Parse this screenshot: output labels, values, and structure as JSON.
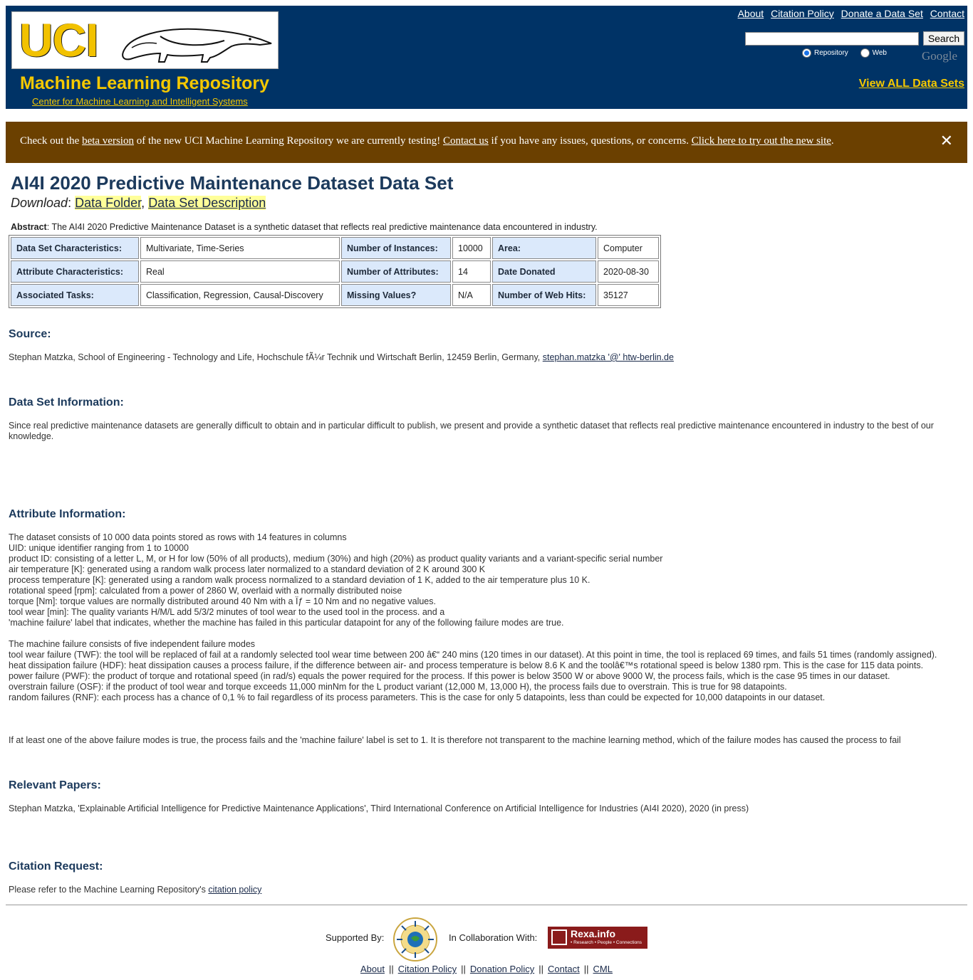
{
  "header": {
    "logo_text": "UCI",
    "title": "Machine Learning Repository",
    "subtitle_link": "Center for Machine Learning and Intelligent Systems",
    "top_links": [
      "About",
      "Citation Policy",
      "Donate a Data Set",
      "Contact"
    ],
    "search_button": "Search",
    "radio_repository": "Repository",
    "radio_web": "Web",
    "google_label": "Google",
    "view_all": "View ALL Data Sets",
    "colors": {
      "background": "#003366",
      "accent": "#f5c800"
    }
  },
  "banner": {
    "text1": "Check out the ",
    "link1": "beta version",
    "text2": " of the new UCI Machine Learning Repository we are currently testing! ",
    "link2": "Contact us",
    "text3": " if you have any issues, questions, or concerns. ",
    "link3": "Click here to try out the new site",
    "text4": ".",
    "close": "✕",
    "color": "#6b4000"
  },
  "dataset": {
    "title": "AI4I 2020 Predictive Maintenance Dataset Data Set",
    "download_label": "Download",
    "download_sep": ":",
    "data_folder": "Data Folder",
    "comma": ",",
    "description": "Data Set Description",
    "abstract_label": "Abstract",
    "abstract_text": ": The AI4I 2020 Predictive Maintenance Dataset is a synthetic dataset that reflects real predictive maintenance data encountered in industry.",
    "table": [
      [
        "Data Set Characteristics:",
        "Multivariate, Time-Series",
        "Number of Instances:",
        "10000",
        "Area:",
        "Computer"
      ],
      [
        "Attribute Characteristics:",
        "Real",
        "Number of Attributes:",
        "14",
        "Date Donated",
        "2020-08-30"
      ],
      [
        "Associated Tasks:",
        "Classification, Regression, Causal-Discovery",
        "Missing Values?",
        "N/A",
        "Number of Web Hits:",
        "35127"
      ]
    ]
  },
  "source": {
    "heading": "Source:",
    "text": "Stephan Matzka, School of Engineering - Technology and Life, Hochschule fÃ¼r Technik und Wirtschaft Berlin, 12459 Berlin, Germany, ",
    "email": "stephan.matzka '@' htw-berlin.de"
  },
  "info": {
    "heading": "Data Set Information:",
    "text": "Since real predictive maintenance datasets are generally difficult to obtain and in particular difficult to publish, we present and provide a synthetic dataset that reflects real predictive maintenance encountered in industry to the best of our knowledge."
  },
  "attributes": {
    "heading": "Attribute Information:",
    "lines": [
      "The dataset consists of 10 000 data points stored as rows with 14 features in columns",
      "UID: unique identifier ranging from 1 to 10000",
      "product ID: consisting of a letter L, M, or H for low (50% of all products), medium (30%) and high (20%) as product quality variants and a variant-specific serial number",
      "air temperature [K]: generated using a random walk process later normalized to a standard deviation of 2 K around 300 K",
      "process temperature [K]: generated using a random walk process normalized to a standard deviation of 1 K, added to the air temperature plus 10 K.",
      "rotational speed [rpm]: calculated from a power of 2860 W, overlaid with a normally distributed noise",
      "torque [Nm]: torque values are normally distributed around 40 Nm with a Ïƒ = 10 Nm and no negative values.",
      "tool wear [min]: The quality variants H/M/L add 5/3/2 minutes of tool wear to the used tool in the process. and a",
      "'machine failure' label that indicates, whether the machine has failed in this particular datapoint for any of the following failure modes are true."
    ],
    "failure_lines": [
      "The machine failure consists of five independent failure modes",
      "tool wear failure (TWF): the tool will be replaced of fail at a randomly selected tool wear time between 200 â€“ 240 mins (120 times in our dataset). At this point in time, the tool is replaced 69 times, and fails 51 times (randomly assigned).",
      "heat dissipation failure (HDF): heat dissipation causes a process failure, if the difference between air- and process temperature is below 8.6 K and the toolâ€™s rotational speed is below 1380 rpm. This is the case for 115 data points.",
      "power failure (PWF): the product of torque and rotational speed (in rad/s) equals the power required for the process. If this power is below 3500 W or above 9000 W, the process fails, which is the case 95 times in our dataset.",
      "overstrain failure (OSF): if the product of tool wear and torque exceeds 11,000 minNm for the L product variant (12,000 M, 13,000 H), the process fails due to overstrain. This is true for 98 datapoints.",
      "random failures (RNF): each process has a chance of 0,1 % to fail regardless of its process parameters. This is the case for only 5 datapoints, less than could be expected for 10,000 datapoints in our dataset."
    ],
    "closing": "If at least one of the above failure modes is true, the process fails and the 'machine failure' label is set to 1. It is therefore not transparent to the machine learning method, which of the failure modes has caused the process to fail"
  },
  "papers": {
    "heading": "Relevant Papers:",
    "text": "Stephan Matzka, 'Explainable Artificial Intelligence for Predictive Maintenance Applications', Third International Conference on Artificial Intelligence for Industries (AI4I 2020), 2020 (in press)"
  },
  "citation": {
    "heading": "Citation Request:",
    "text": "Please refer to the Machine Learning Repository's ",
    "link": "citation policy"
  },
  "footer": {
    "supported_by": "Supported By:",
    "collab": "In Collaboration With:",
    "rexa_name": "Rexa.info",
    "rexa_tag": "• Research • People • Connections",
    "links": [
      "About",
      "Citation Policy",
      "Donation Policy",
      "Contact",
      "CML"
    ],
    "sep": "||"
  }
}
